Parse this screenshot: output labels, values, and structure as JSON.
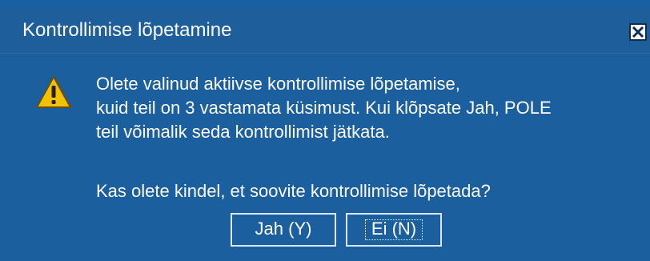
{
  "window": {
    "title": "Kontrollimise lõpetamine"
  },
  "icons": {
    "close": "close-icon",
    "warning": "warning-icon"
  },
  "message": {
    "line1": "Olete valinud aktiivse kontrollimise lõpetamise,",
    "line2": "kuid teil on 3 vastamata küsimust. Kui klõpsate Jah, POLE",
    "line3": "teil võimalik seda kontrollimist jätkata.",
    "question": "Kas olete kindel, et soovite kontrollimise lõpetada?"
  },
  "buttons": {
    "yes_label": "Jah (Y)",
    "no_label": "Ei (N)"
  },
  "colors": {
    "dialog_background": "#1960a2",
    "text": "#ffffff",
    "warning_yellow": "#f2c200"
  }
}
